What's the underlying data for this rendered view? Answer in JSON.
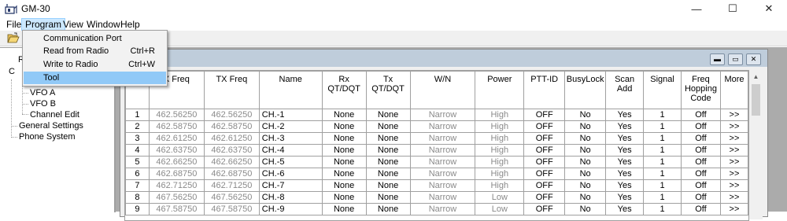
{
  "window": {
    "title": "GM-30",
    "minimize": "—",
    "maximize": "☐",
    "close": "✕"
  },
  "menubar": [
    "File",
    "Program",
    "View",
    "Window",
    "Help"
  ],
  "program_menu": {
    "items": [
      {
        "label": "Communication Port",
        "shortcut": ""
      },
      {
        "label": "Read from Radio",
        "shortcut": "Ctrl+R"
      },
      {
        "label": "Write to Radio",
        "shortcut": "Ctrl+W"
      },
      {
        "label": "Tool",
        "shortcut": ""
      }
    ],
    "highlighted": "Tool"
  },
  "tree": {
    "partial_r": "R",
    "partial_c": "C",
    "items": [
      "VFO A",
      "VFO B",
      "Channel Edit",
      "General Settings",
      "Phone System"
    ]
  },
  "grid": {
    "headers": [
      "",
      "RX Freq",
      "TX Freq",
      "Name",
      "Rx QT/DQT",
      "Tx QT/DQT",
      "W/N",
      "Power",
      "PTT-ID",
      "BusyLock",
      "Scan Add",
      "Signal",
      "Freq Hopping Code",
      "More"
    ],
    "header_partial_rx": "X Freq",
    "rows": [
      [
        "1",
        "462.56250",
        "462.56250",
        "CH.-1",
        "None",
        "None",
        "Narrow",
        "High",
        "OFF",
        "No",
        "Yes",
        "1",
        "Off",
        ">>"
      ],
      [
        "2",
        "462.58750",
        "462.58750",
        "CH.-2",
        "None",
        "None",
        "Narrow",
        "High",
        "OFF",
        "No",
        "Yes",
        "1",
        "Off",
        ">>"
      ],
      [
        "3",
        "462.61250",
        "462.61250",
        "CH.-3",
        "None",
        "None",
        "Narrow",
        "High",
        "OFF",
        "No",
        "Yes",
        "1",
        "Off",
        ">>"
      ],
      [
        "4",
        "462.63750",
        "462.63750",
        "CH.-4",
        "None",
        "None",
        "Narrow",
        "High",
        "OFF",
        "No",
        "Yes",
        "1",
        "Off",
        ">>"
      ],
      [
        "5",
        "462.66250",
        "462.66250",
        "CH.-5",
        "None",
        "None",
        "Narrow",
        "High",
        "OFF",
        "No",
        "Yes",
        "1",
        "Off",
        ">>"
      ],
      [
        "6",
        "462.68750",
        "462.68750",
        "CH.-6",
        "None",
        "None",
        "Narrow",
        "High",
        "OFF",
        "No",
        "Yes",
        "1",
        "Off",
        ">>"
      ],
      [
        "7",
        "462.71250",
        "462.71250",
        "CH.-7",
        "None",
        "None",
        "Narrow",
        "High",
        "OFF",
        "No",
        "Yes",
        "1",
        "Off",
        ">>"
      ],
      [
        "8",
        "467.56250",
        "467.56250",
        "CH.-8",
        "None",
        "None",
        "Narrow",
        "Low",
        "OFF",
        "No",
        "Yes",
        "1",
        "Off",
        ">>"
      ],
      [
        "9",
        "467.58750",
        "467.58750",
        "CH.-9",
        "None",
        "None",
        "Narrow",
        "Low",
        "OFF",
        "No",
        "Yes",
        "1",
        "Off",
        ">>"
      ]
    ]
  },
  "colors": {
    "menu_highlight": "#91c9f7",
    "disabled_text": "#8a8a8a",
    "mdi_background": "#ababab"
  }
}
